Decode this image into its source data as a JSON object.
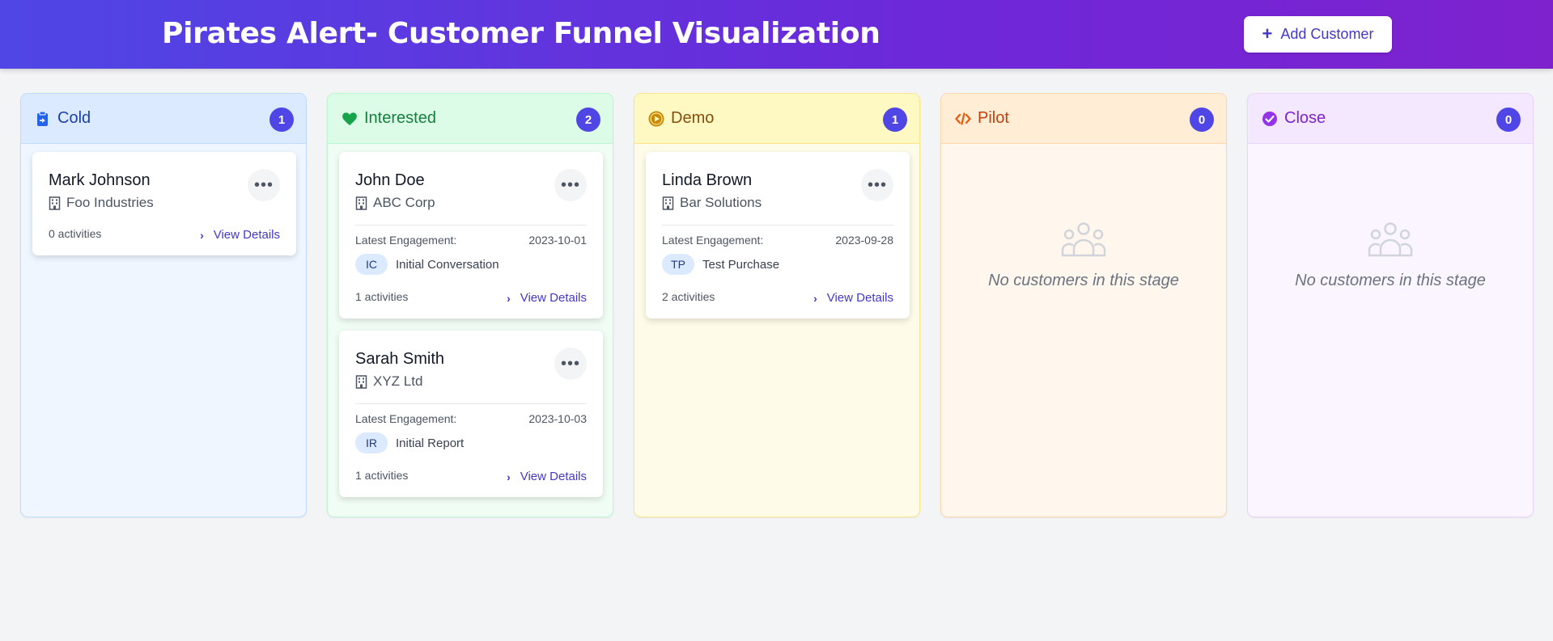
{
  "header": {
    "title": "Pirates Alert- Customer Funnel Visualization",
    "add_button_label": "Add Customer"
  },
  "labels": {
    "latest_engagement": "Latest Engagement:",
    "view_details": "View Details",
    "empty_message": "No customers in this stage"
  },
  "columns": [
    {
      "title": "Cold",
      "count": "1",
      "icon": "clipboard-icon",
      "color": "#1e40af",
      "bg": "#eff6ff",
      "head_bg": "#dbeafe",
      "border": "#bfdbfe",
      "cards": [
        {
          "name": "Mark Johnson",
          "company": "Foo Industries",
          "activities": "0 activities"
        }
      ]
    },
    {
      "title": "Interested",
      "count": "2",
      "icon": "heart-icon",
      "color": "#15803d",
      "bg": "#f0fdf4",
      "head_bg": "#dcfce7",
      "border": "#bbf7d0",
      "cards": [
        {
          "name": "John Doe",
          "company": "ABC Corp",
          "date": "2023-10-01",
          "badge": "IC",
          "engagement": "Initial Conversation",
          "activities": "1 activities"
        },
        {
          "name": "Sarah Smith",
          "company": "XYZ Ltd",
          "date": "2023-10-03",
          "badge": "IR",
          "engagement": "Initial Report",
          "activities": "1 activities"
        }
      ]
    },
    {
      "title": "Demo",
      "count": "1",
      "icon": "play-circle-icon",
      "color": "#854d0e",
      "bg": "#fefce8",
      "head_bg": "#fef9c3",
      "border": "#fde68a",
      "cards": [
        {
          "name": "Linda Brown",
          "company": "Bar Solutions",
          "date": "2023-09-28",
          "badge": "TP",
          "engagement": "Test Purchase",
          "activities": "2 activities"
        }
      ]
    },
    {
      "title": "Pilot",
      "count": "0",
      "icon": "code-icon",
      "color": "#c2410c",
      "bg": "#fff7ed",
      "head_bg": "#ffedd5",
      "border": "#fed7aa",
      "cards": []
    },
    {
      "title": "Close",
      "count": "0",
      "icon": "check-circle-icon",
      "color": "#7e22ce",
      "bg": "#faf5ff",
      "head_bg": "#f3e8ff",
      "border": "#e9d5ff",
      "cards": []
    }
  ]
}
